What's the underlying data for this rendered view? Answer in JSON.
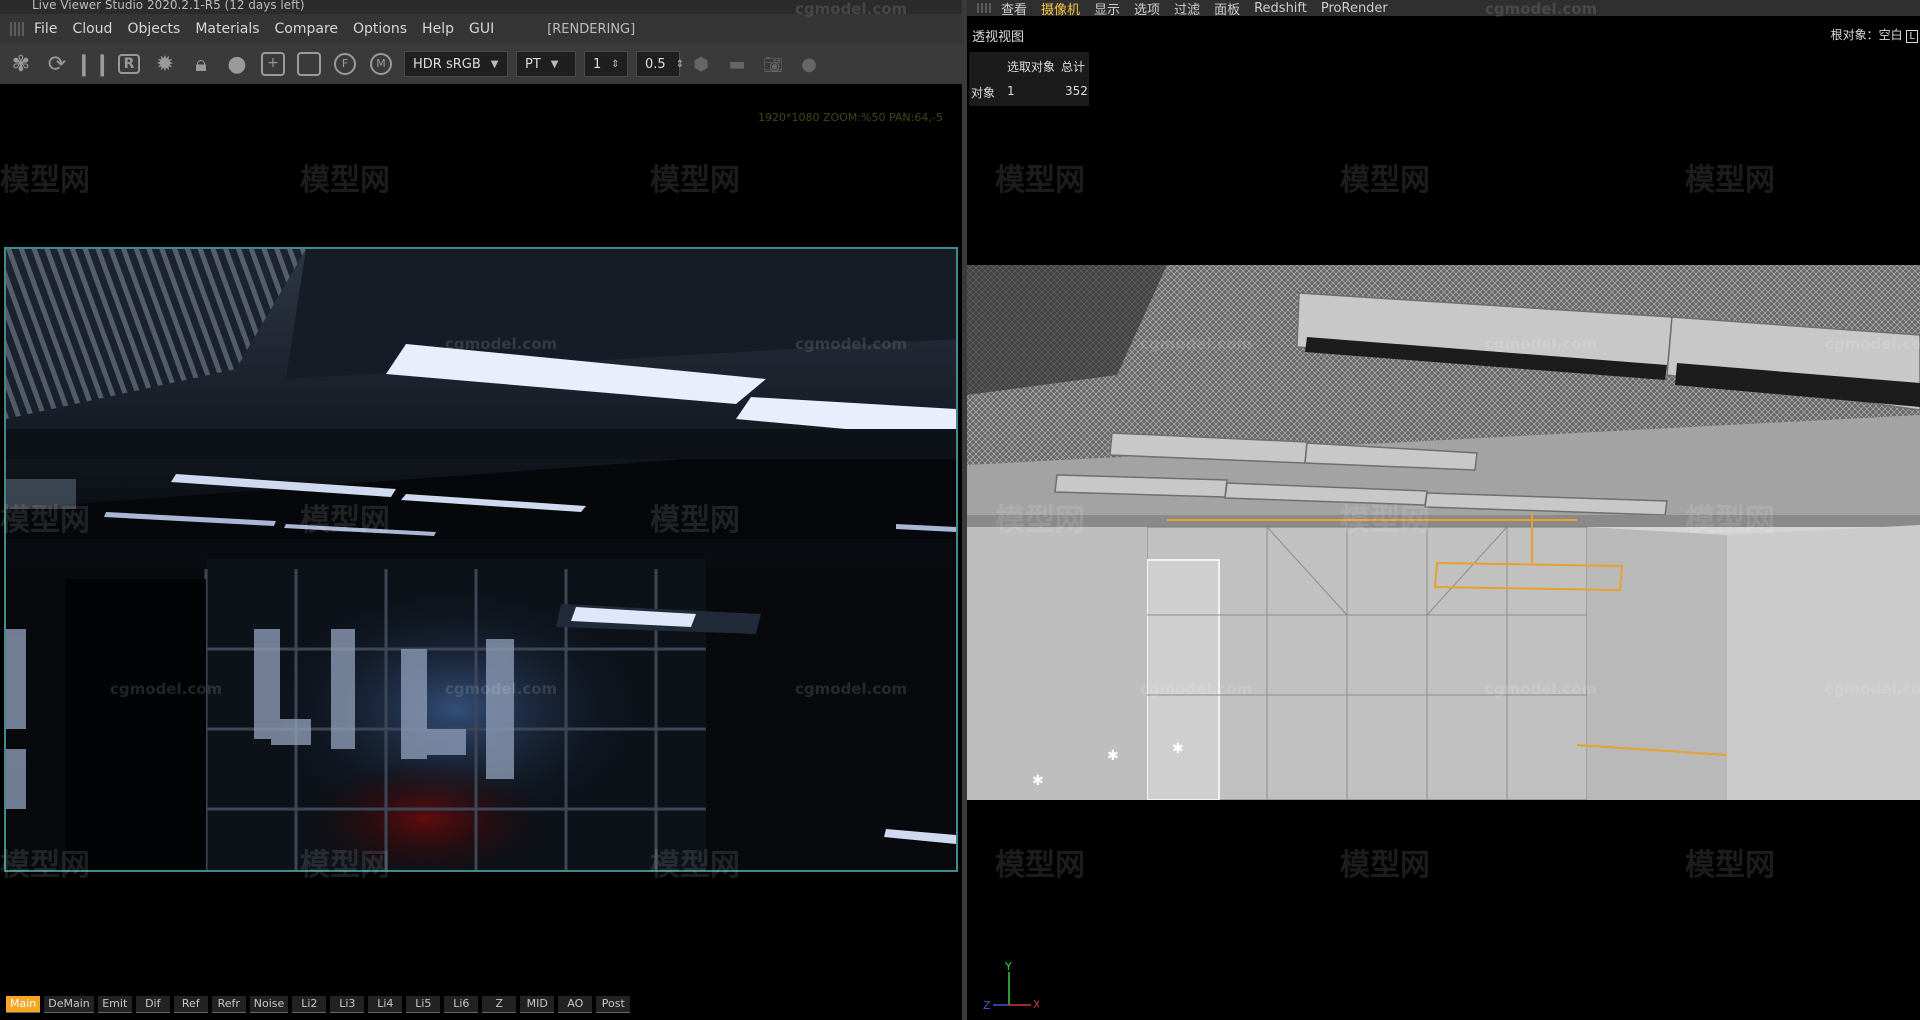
{
  "left_window": {
    "title": "Live Viewer Studio 2020.2.1-R5 (12 days left)",
    "menu": [
      "File",
      "Cloud",
      "Objects",
      "Materials",
      "Compare",
      "Options",
      "Help",
      "GUI"
    ],
    "render_status": "[RENDERING]",
    "toolbar": {
      "icons": [
        "flower-icon",
        "refresh-icon",
        "pause-icon",
        "region-render-icon",
        "settings-gear-icon",
        "lock-icon",
        "sphere-icon",
        "add-region-icon",
        "region-box-icon",
        "film-icon",
        "material-icon"
      ],
      "color_mode": "HDR sRGB",
      "kernel": "PT",
      "spinner_a": "1",
      "spinner_b": "0.5",
      "extra_icons": [
        "hexagon-icon",
        "film-strip-icon",
        "camera-icon",
        "sphere-dark-icon"
      ]
    },
    "zoom_info": "1920*1080 ZOOM:%50  PAN:64,-5",
    "passes": [
      "Main",
      "DeMain",
      "Emit",
      "Dif",
      "Ref",
      "Refr",
      "Noise",
      "Li2",
      "Li3",
      "Li4",
      "Li5",
      "Li6",
      "Z",
      "MID",
      "AO",
      "Post"
    ],
    "active_pass": "Main"
  },
  "right_window": {
    "menu": [
      "查看",
      "摄像机",
      "显示",
      "选项",
      "过滤",
      "面板",
      "Redshift",
      "ProRender"
    ],
    "active_menu": "摄像机",
    "viewport_title": "透视视图",
    "root_label": "根对象：空白",
    "stats": {
      "col_selected": "选取对象",
      "col_total": "总计",
      "row_label": "对象",
      "selected": "1",
      "total": "352"
    },
    "axis": {
      "x": "X",
      "y": "Y",
      "z": "Z"
    }
  },
  "watermarks": {
    "brand": "模型网",
    "url": "cgmodel.com"
  },
  "colors": {
    "active_tab": "#f5a623",
    "render_border": "#3f8a8a",
    "selection": "#e8a030"
  }
}
